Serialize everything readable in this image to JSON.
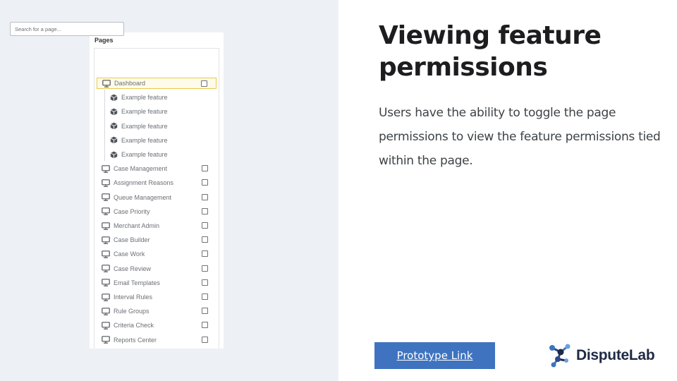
{
  "pages_panel": {
    "title": "Pages",
    "search_placeholder": "Search for a page...",
    "items": [
      {
        "label": "Dashboard",
        "type": "page",
        "selected": true,
        "icon": "monitor-icon"
      },
      {
        "label": "Example feature",
        "type": "feature",
        "icon": "cube-icon"
      },
      {
        "label": "Example feature",
        "type": "feature",
        "icon": "cube-icon"
      },
      {
        "label": "Example feature",
        "type": "feature",
        "icon": "cube-icon"
      },
      {
        "label": "Example feature",
        "type": "feature",
        "icon": "cube-icon"
      },
      {
        "label": "Example feature",
        "type": "feature",
        "icon": "cube-icon"
      },
      {
        "label": "Case Management",
        "type": "page",
        "icon": "monitor-icon"
      },
      {
        "label": "Assignment Reasons",
        "type": "page",
        "icon": "monitor-icon"
      },
      {
        "label": "Queue Management",
        "type": "page",
        "icon": "monitor-icon"
      },
      {
        "label": "Case Priority",
        "type": "page",
        "icon": "monitor-icon"
      },
      {
        "label": "Merchant Admin",
        "type": "page",
        "icon": "monitor-icon"
      },
      {
        "label": "Case Builder",
        "type": "page",
        "icon": "monitor-icon"
      },
      {
        "label": "Case Work",
        "type": "page",
        "icon": "monitor-icon"
      },
      {
        "label": "Case Review",
        "type": "page",
        "icon": "monitor-icon"
      },
      {
        "label": "Email Templates",
        "type": "page",
        "icon": "monitor-icon"
      },
      {
        "label": "Interval Rules",
        "type": "page",
        "icon": "monitor-icon"
      },
      {
        "label": "Rule Groups",
        "type": "page",
        "icon": "monitor-icon"
      },
      {
        "label": "Criteria Check",
        "type": "page",
        "icon": "monitor-icon"
      },
      {
        "label": "Reports Center",
        "type": "page",
        "icon": "monitor-icon"
      }
    ]
  },
  "slide": {
    "heading": "Viewing feature permissions",
    "body": "Users have the ability to toggle the page permissions to view the feature permissions tied within the page.",
    "button_label": "Prototype  Link",
    "logo_text": "DisputeLab"
  },
  "colors": {
    "accent_button": "#3f73bf",
    "selected_highlight": "#e9c94d",
    "left_background": "#edf0f4"
  }
}
